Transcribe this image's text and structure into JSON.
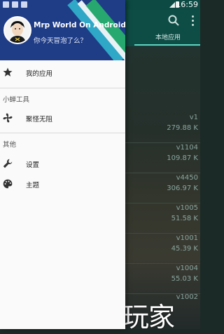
{
  "status_bar": {
    "time": "16:59"
  },
  "drawer": {
    "header": {
      "username": "Mrp World On Android",
      "tagline": "你今天冒泡了么？"
    },
    "items": [
      {
        "label": "我的应用",
        "icon": "star-icon"
      }
    ],
    "sections": [
      {
        "title": "小蝉工具",
        "items": [
          {
            "label": "聚怪无阻",
            "icon": "fan-icon"
          }
        ]
      },
      {
        "title": "其他",
        "items": [
          {
            "label": "设置",
            "icon": "wrench-icon"
          },
          {
            "label": "主题",
            "icon": "palette-icon"
          }
        ]
      }
    ]
  },
  "app": {
    "tab": "本地应用",
    "list": [
      {
        "version": "v1",
        "size": "279.88 K"
      },
      {
        "version": "v1104",
        "size": "109.87 K"
      },
      {
        "version": "v4450",
        "size": "306.97 K"
      },
      {
        "version": "v1005",
        "size": "51.58 K"
      },
      {
        "version": "v1001",
        "size": "45.39 K"
      },
      {
        "version": "v1004",
        "size": "55.03 K"
      },
      {
        "version": "v1002",
        "size": ""
      }
    ]
  },
  "watermark": "大玩家"
}
